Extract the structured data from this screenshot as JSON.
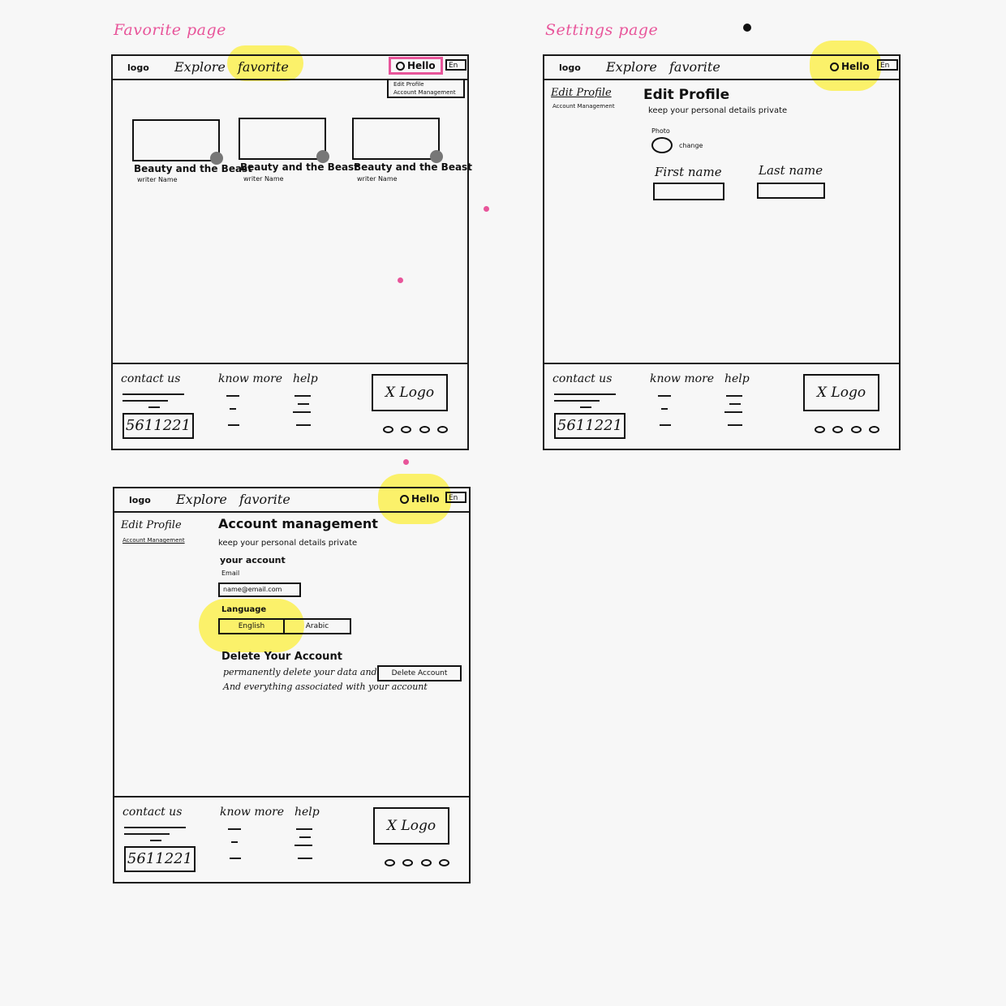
{
  "titles": {
    "favorite": "Favorite page",
    "settings": "Settings page"
  },
  "nav": {
    "logo": "logo",
    "explore": "Explore",
    "favorite": "favorite",
    "hello": "Hello",
    "lang": "En"
  },
  "dropdown": {
    "edit_profile": "Edit Profile",
    "account_management": "Account Management"
  },
  "favorite_cards": [
    {
      "title": "Beauty and the Beast",
      "sub": "writer Name"
    },
    {
      "title": "Beauty and the Beast",
      "sub": "writer Name"
    },
    {
      "title": "Beauty and the Beast",
      "sub": "writer Name"
    }
  ],
  "settings": {
    "side_edit": "Edit Profile",
    "side_account": "Account Management",
    "heading": "Edit Profile",
    "subtitle": "keep your personal details private",
    "photo_label": "Photo",
    "change": "change",
    "first_name": "First name",
    "last_name": "Last name"
  },
  "account": {
    "side_edit": "Edit Profile",
    "side_account": "Account Management",
    "heading": "Account management",
    "subtitle": "keep your personal details private",
    "your_account": "your account",
    "email_label": "Email",
    "email_value": "name@email.com",
    "language_label": "Language",
    "lang_option_1": "English",
    "lang_option_2": "Arabic",
    "delete_heading": "Delete Your Account",
    "delete_text_1": "permanently delete your data and",
    "delete_text_2": "And everything associated with your account",
    "delete_button": "Delete Account"
  },
  "footer": {
    "contact": "contact us",
    "know_more": "know more",
    "help": "help",
    "phone": "5611221",
    "logo": "X Logo"
  },
  "colors": {
    "highlight": "#fbef5a",
    "pink": "#e8559a"
  }
}
